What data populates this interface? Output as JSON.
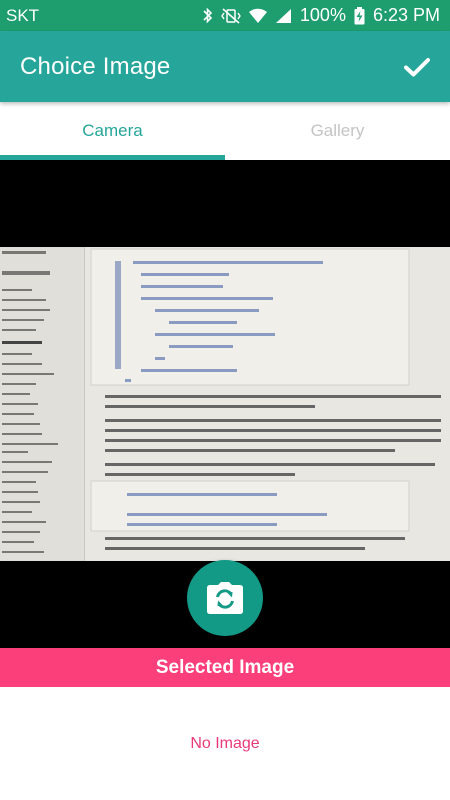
{
  "status_bar": {
    "carrier": "SKT",
    "battery": "100%",
    "time": "6:23 PM",
    "icons": [
      "bluetooth-icon",
      "vibrate-mute-icon",
      "wifi-icon",
      "signal-icon",
      "battery-charging-icon"
    ]
  },
  "app_bar": {
    "title": "Choice Image",
    "confirm_icon": "check-icon",
    "color": "#26a69a"
  },
  "tabs": [
    {
      "label": "Camera",
      "active": true
    },
    {
      "label": "Gallery",
      "active": false
    }
  ],
  "camera_button": {
    "icon": "camera-switch-icon",
    "color": "#139a86"
  },
  "selected_section": {
    "label": "Selected Image",
    "color": "#fa3f7a",
    "empty_text": "No Image"
  }
}
